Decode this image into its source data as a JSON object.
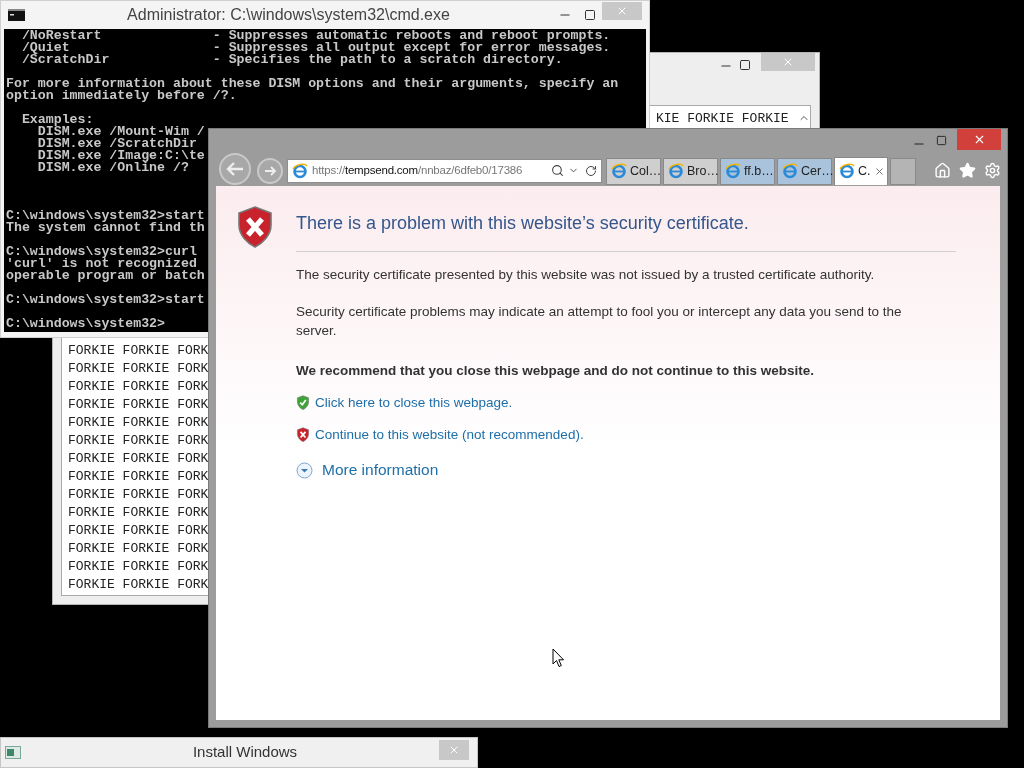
{
  "cmd_window": {
    "title": "Administrator: C:\\windows\\system32\\cmd.exe",
    "lines": [
      {
        "kind": "text",
        "text": "  /NoRestart              - Suppresses automatic reboots and reboot prompts."
      },
      {
        "kind": "text",
        "text": "  /Quiet                  - Suppresses all output except for error messages."
      },
      {
        "kind": "text",
        "text": "  /ScratchDir             - Specifies the path to a scratch directory."
      },
      {
        "kind": "blank"
      },
      {
        "kind": "text",
        "text": "For more information about these DISM options and their arguments, specify an"
      },
      {
        "kind": "text",
        "text": "option immediately before /?."
      },
      {
        "kind": "blank"
      },
      {
        "kind": "text",
        "text": "  Examples:"
      },
      {
        "kind": "text",
        "text": "    DISM.exe /Mount-Wim /"
      },
      {
        "kind": "text",
        "text": "    DISM.exe /ScratchDir"
      },
      {
        "kind": "text",
        "text": "    DISM.exe /Image:C:\\te"
      },
      {
        "kind": "text",
        "text": "    DISM.exe /Online /?"
      },
      {
        "kind": "blank"
      },
      {
        "kind": "blank"
      },
      {
        "kind": "blank"
      },
      {
        "kind": "text",
        "text": "C:\\windows\\system32>start"
      },
      {
        "kind": "text",
        "text": "The system cannot find th"
      },
      {
        "kind": "blank"
      },
      {
        "kind": "text",
        "text": "C:\\windows\\system32>curl"
      },
      {
        "kind": "text",
        "text": "'curl' is not recognized"
      },
      {
        "kind": "text",
        "text": "operable program or batch"
      },
      {
        "kind": "blank"
      },
      {
        "kind": "text",
        "text": "C:\\windows\\system32>start"
      },
      {
        "kind": "blank"
      },
      {
        "kind": "text",
        "text": "C:\\windows\\system32>"
      }
    ]
  },
  "notepad_window": {
    "lines_top": [
      "KIE FORKIE FORKIE"
    ],
    "lines_bottom": [
      "FORKIE FORKIE FORK",
      "FORKIE FORKIE FORK",
      "FORKIE FORKIE FORK",
      "FORKIE FORKIE FORK",
      "FORKIE FORKIE FORK",
      "FORKIE FORKIE FORK",
      "FORKIE FORKIE FORK",
      "FORKIE FORKIE FORK",
      "FORKIE FORKIE FORK",
      "FORKIE FORKIE FORK",
      "FORKIE FORKIE FORK",
      "FORKIE FORKIE FORK",
      "FORKIE FORKIE FORK",
      "FORKIE FORKIE FORK"
    ]
  },
  "browser_window": {
    "address": {
      "scheme": "https://",
      "domain": "tempsend.com",
      "path": "/nnbaz/6dfeb0/17386"
    },
    "tabs": [
      {
        "label": "Col…",
        "selected": false,
        "color": "#cfcfcf"
      },
      {
        "label": "Bro…",
        "selected": false,
        "color": "#cfcfcf"
      },
      {
        "label": "ff.b…",
        "selected": false,
        "color": "#a9c3dc"
      },
      {
        "label": "Cer…",
        "selected": false,
        "color": "#a9c3dc"
      },
      {
        "label": "C.",
        "selected": true,
        "color": "#ffffff"
      }
    ],
    "page": {
      "heading": "There is a problem with this website’s security certificate.",
      "paragraphs": [
        "The security certificate presented by this website was not issued by a trusted certificate authority.",
        "Security certificate problems may indicate an attempt to fool you or intercept any data you send to the server."
      ],
      "recommendation": "We recommend that you close this webpage and do not continue to this website.",
      "links": [
        {
          "text": "Click here to close this webpage.",
          "kind": "safe"
        },
        {
          "text": "Continue to this website (not recommended).",
          "kind": "unsafe"
        }
      ],
      "more_info": "More information"
    }
  },
  "install_window": {
    "title": "Install Windows"
  }
}
